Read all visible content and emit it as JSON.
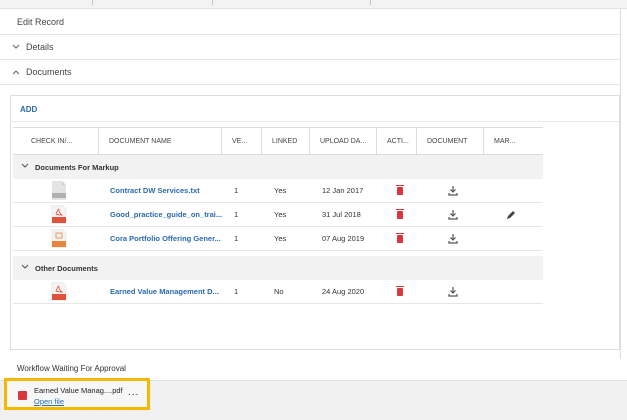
{
  "header": {
    "title": "Edit Record"
  },
  "sections": {
    "details": "Details",
    "documents": "Documents"
  },
  "toolbar": {
    "add_label": "ADD"
  },
  "columns": [
    "CHECK IN/...",
    "DOCUMENT NAME",
    "VE...",
    "LINKED",
    "UPLOAD DA...",
    "ACTI...",
    "DOCUMENT",
    "MAR..."
  ],
  "groups": [
    {
      "label": "Documents For Markup",
      "rows": [
        {
          "file_type": "TXT",
          "icon": "txt-file-icon",
          "name": "Contract DW Services.txt",
          "version": "1",
          "linked": "Yes",
          "date": "12 Jan 2017",
          "markup": false
        },
        {
          "file_type": "PDF",
          "icon": "pdf-file-icon",
          "name": "Good_practice_guide_on_trai...",
          "version": "1",
          "linked": "Yes",
          "date": "31 Jul 2018",
          "markup": true
        },
        {
          "file_type": "PPT",
          "icon": "ppt-file-icon",
          "name": "Cora Portfolio Offering Gener...",
          "version": "1",
          "linked": "Yes",
          "date": "07 Aug 2019",
          "markup": false
        }
      ]
    },
    {
      "label": "Other Documents",
      "rows": [
        {
          "file_type": "PDF",
          "icon": "pdf-file-icon",
          "name": "Earned Value Management D...",
          "version": "1",
          "linked": "No",
          "date": "24 Aug 2020",
          "markup": false
        }
      ]
    }
  ],
  "workflow": {
    "label": "Workflow Waiting For Approval"
  },
  "download": {
    "filename": "Earned Value Manag....pdf",
    "open_label": "Open file",
    "more_label": "..."
  },
  "colors": {
    "link": "#2a6bb0",
    "delete": "#d9363e",
    "pdf": "#e0533a",
    "ppt": "#e8853a",
    "highlight": "#f5b800"
  }
}
